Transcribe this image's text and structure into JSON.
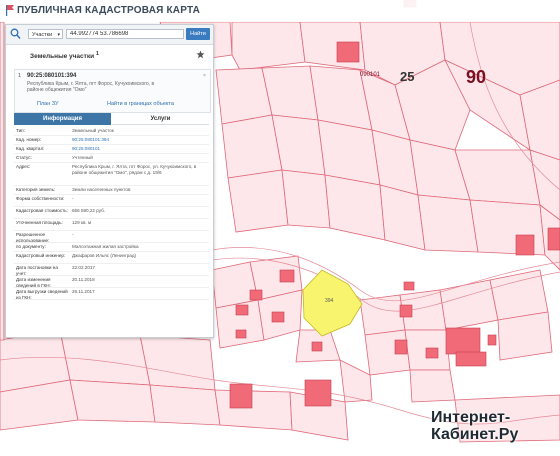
{
  "header": {
    "title": "ПУБЛИЧНАЯ КАДАСТРОВАЯ КАРТА"
  },
  "search": {
    "type_label": "Участки",
    "query": "44.992774 53.786698",
    "button_label": "Найти"
  },
  "results": {
    "title": "Земельные участки",
    "title_count": "1",
    "item": {
      "index": "1",
      "cad_number": "90:25:080101:394",
      "address": "Республика Крым, г. Ялта, пгт Форос, Кучукоимского, в районе общежития \"Омо\"",
      "action_left": "План ЗУ",
      "action_right": "Найти в границах объекта"
    }
  },
  "tabs": {
    "info": "Информация",
    "services": "Услуги"
  },
  "details": [
    {
      "key": "Тип:",
      "value": "Земельный участок"
    },
    {
      "key": "Кад. номер:",
      "value": "90:25:080101:394",
      "link": true
    },
    {
      "key": "Кад. квартал:",
      "value": "90:25:080101",
      "link": true
    },
    {
      "key": "Статус:",
      "value": "Учтенный"
    },
    {
      "key": "Адрес:",
      "value": "Республика Крым, г. Ялта, пгт Форос, ул. Кучукоимского, в районе общежития \"Омо\", рядом с д. 19/6"
    },
    {
      "key": "Категория земель:",
      "value": "Земли населенных пунктов"
    },
    {
      "key": "Форма собственности:",
      "value": "-"
    },
    {
      "key": "Кадастровая стоимость:",
      "value": "656 590,22 руб."
    },
    {
      "key": "Уточненная площадь:",
      "value": "129 кв. м"
    },
    {
      "key": "Разрешенное использование:",
      "value": "-"
    },
    {
      "key": "по документу:",
      "value": "Малоэтажная жилая застройка"
    },
    {
      "key": "Кадастровый инженер:",
      "value": "Джафаров Ильяс (Ленинград)"
    },
    {
      "key": "Дата постановки на учет:",
      "value": "22.02.2017"
    },
    {
      "key": "Дата изменения сведений в ГКН:",
      "value": "20.11.2018"
    },
    {
      "key": "Дата выгрузки сведений из ГКН:",
      "value": "26.11.2017"
    }
  ],
  "map": {
    "labels": [
      "25",
      "90"
    ],
    "small_label": "090101",
    "parcel_label": "394"
  },
  "watermark": {
    "line1": "Интернет-",
    "line2": "Кабинет.Ру"
  },
  "colors": {
    "parcel_fill": "#fde0e6",
    "parcel_stroke": "#e05a6a",
    "building_fill": "#f06070",
    "selected_parcel": "#f7f36a",
    "accent": "#3b7bc0",
    "tab_active": "#3d75a7"
  },
  "icons": {
    "logo": "flag-icon",
    "search": "search-icon",
    "pin": "pin-icon"
  }
}
